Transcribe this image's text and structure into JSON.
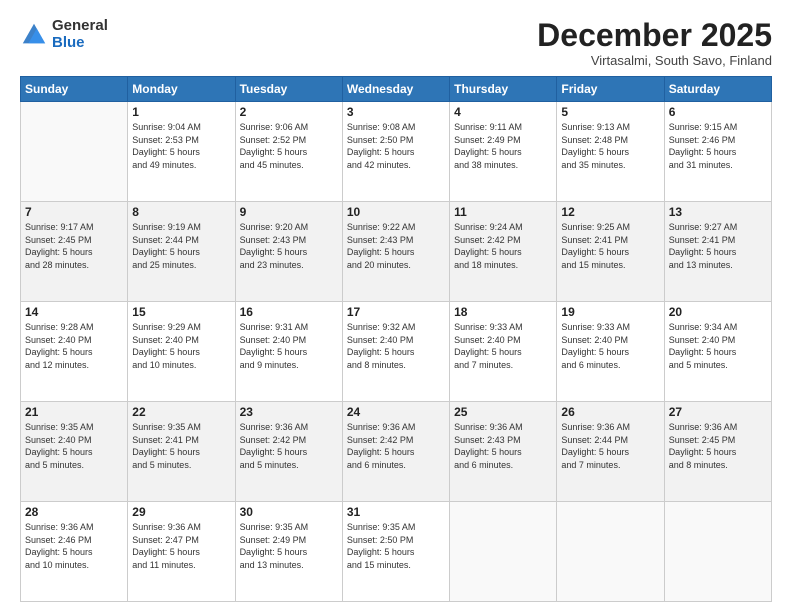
{
  "header": {
    "logo": {
      "general": "General",
      "blue": "Blue"
    },
    "title": "December 2025",
    "subtitle": "Virtasalmi, South Savo, Finland"
  },
  "days_of_week": [
    "Sunday",
    "Monday",
    "Tuesday",
    "Wednesday",
    "Thursday",
    "Friday",
    "Saturday"
  ],
  "weeks": [
    [
      {
        "day": "",
        "info": ""
      },
      {
        "day": "1",
        "info": "Sunrise: 9:04 AM\nSunset: 2:53 PM\nDaylight: 5 hours\nand 49 minutes."
      },
      {
        "day": "2",
        "info": "Sunrise: 9:06 AM\nSunset: 2:52 PM\nDaylight: 5 hours\nand 45 minutes."
      },
      {
        "day": "3",
        "info": "Sunrise: 9:08 AM\nSunset: 2:50 PM\nDaylight: 5 hours\nand 42 minutes."
      },
      {
        "day": "4",
        "info": "Sunrise: 9:11 AM\nSunset: 2:49 PM\nDaylight: 5 hours\nand 38 minutes."
      },
      {
        "day": "5",
        "info": "Sunrise: 9:13 AM\nSunset: 2:48 PM\nDaylight: 5 hours\nand 35 minutes."
      },
      {
        "day": "6",
        "info": "Sunrise: 9:15 AM\nSunset: 2:46 PM\nDaylight: 5 hours\nand 31 minutes."
      }
    ],
    [
      {
        "day": "7",
        "info": "Sunrise: 9:17 AM\nSunset: 2:45 PM\nDaylight: 5 hours\nand 28 minutes."
      },
      {
        "day": "8",
        "info": "Sunrise: 9:19 AM\nSunset: 2:44 PM\nDaylight: 5 hours\nand 25 minutes."
      },
      {
        "day": "9",
        "info": "Sunrise: 9:20 AM\nSunset: 2:43 PM\nDaylight: 5 hours\nand 23 minutes."
      },
      {
        "day": "10",
        "info": "Sunrise: 9:22 AM\nSunset: 2:43 PM\nDaylight: 5 hours\nand 20 minutes."
      },
      {
        "day": "11",
        "info": "Sunrise: 9:24 AM\nSunset: 2:42 PM\nDaylight: 5 hours\nand 18 minutes."
      },
      {
        "day": "12",
        "info": "Sunrise: 9:25 AM\nSunset: 2:41 PM\nDaylight: 5 hours\nand 15 minutes."
      },
      {
        "day": "13",
        "info": "Sunrise: 9:27 AM\nSunset: 2:41 PM\nDaylight: 5 hours\nand 13 minutes."
      }
    ],
    [
      {
        "day": "14",
        "info": "Sunrise: 9:28 AM\nSunset: 2:40 PM\nDaylight: 5 hours\nand 12 minutes."
      },
      {
        "day": "15",
        "info": "Sunrise: 9:29 AM\nSunset: 2:40 PM\nDaylight: 5 hours\nand 10 minutes."
      },
      {
        "day": "16",
        "info": "Sunrise: 9:31 AM\nSunset: 2:40 PM\nDaylight: 5 hours\nand 9 minutes."
      },
      {
        "day": "17",
        "info": "Sunrise: 9:32 AM\nSunset: 2:40 PM\nDaylight: 5 hours\nand 8 minutes."
      },
      {
        "day": "18",
        "info": "Sunrise: 9:33 AM\nSunset: 2:40 PM\nDaylight: 5 hours\nand 7 minutes."
      },
      {
        "day": "19",
        "info": "Sunrise: 9:33 AM\nSunset: 2:40 PM\nDaylight: 5 hours\nand 6 minutes."
      },
      {
        "day": "20",
        "info": "Sunrise: 9:34 AM\nSunset: 2:40 PM\nDaylight: 5 hours\nand 5 minutes."
      }
    ],
    [
      {
        "day": "21",
        "info": "Sunrise: 9:35 AM\nSunset: 2:40 PM\nDaylight: 5 hours\nand 5 minutes."
      },
      {
        "day": "22",
        "info": "Sunrise: 9:35 AM\nSunset: 2:41 PM\nDaylight: 5 hours\nand 5 minutes."
      },
      {
        "day": "23",
        "info": "Sunrise: 9:36 AM\nSunset: 2:42 PM\nDaylight: 5 hours\nand 5 minutes."
      },
      {
        "day": "24",
        "info": "Sunrise: 9:36 AM\nSunset: 2:42 PM\nDaylight: 5 hours\nand 6 minutes."
      },
      {
        "day": "25",
        "info": "Sunrise: 9:36 AM\nSunset: 2:43 PM\nDaylight: 5 hours\nand 6 minutes."
      },
      {
        "day": "26",
        "info": "Sunrise: 9:36 AM\nSunset: 2:44 PM\nDaylight: 5 hours\nand 7 minutes."
      },
      {
        "day": "27",
        "info": "Sunrise: 9:36 AM\nSunset: 2:45 PM\nDaylight: 5 hours\nand 8 minutes."
      }
    ],
    [
      {
        "day": "28",
        "info": "Sunrise: 9:36 AM\nSunset: 2:46 PM\nDaylight: 5 hours\nand 10 minutes."
      },
      {
        "day": "29",
        "info": "Sunrise: 9:36 AM\nSunset: 2:47 PM\nDaylight: 5 hours\nand 11 minutes."
      },
      {
        "day": "30",
        "info": "Sunrise: 9:35 AM\nSunset: 2:49 PM\nDaylight: 5 hours\nand 13 minutes."
      },
      {
        "day": "31",
        "info": "Sunrise: 9:35 AM\nSunset: 2:50 PM\nDaylight: 5 hours\nand 15 minutes."
      },
      {
        "day": "",
        "info": ""
      },
      {
        "day": "",
        "info": ""
      },
      {
        "day": "",
        "info": ""
      }
    ]
  ]
}
